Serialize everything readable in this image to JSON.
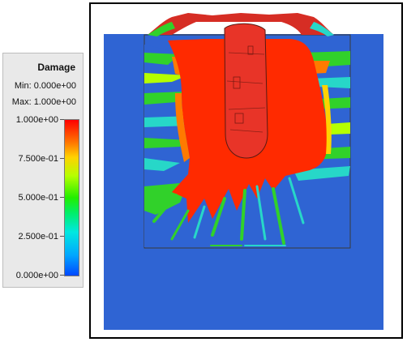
{
  "legend": {
    "title": "Damage",
    "min_label": "Min: 0.000e+00",
    "max_label": "Max: 1.000e+00",
    "ticks": [
      "1.000e+00",
      "7.500e-01",
      "5.000e-01",
      "2.500e-01",
      "0.000e+00"
    ]
  },
  "colors": {
    "low": "#2f64d3",
    "high": "#ff2a00",
    "mid_green": "#31d12a",
    "cyan": "#27d7c8"
  }
}
